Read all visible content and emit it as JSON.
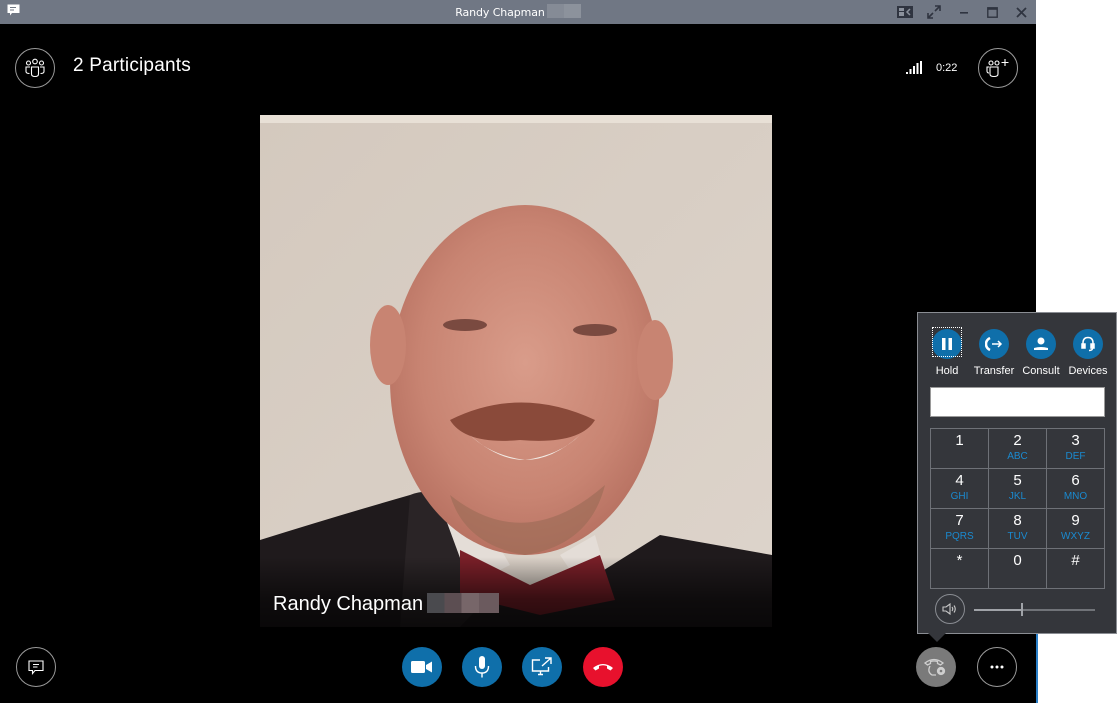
{
  "window": {
    "title": "Randy Chapman",
    "title_redacted": true,
    "controls": [
      "compact-view",
      "full-screen",
      "minimize",
      "maximize",
      "close"
    ]
  },
  "header": {
    "participants_label": "2 Participants",
    "call_duration": "0:22",
    "signal_icon": "signal-strength-icon",
    "add_people_icon": "add-people-icon"
  },
  "video": {
    "participant_name": "Randy Chapman",
    "name_redacted": true
  },
  "toolbar": {
    "im_icon": "chat-icon",
    "video_icon": "video-camera-icon",
    "mic_icon": "microphone-icon",
    "share_icon": "present-screen-icon",
    "hangup_icon": "end-call-icon",
    "call_controls_icon": "call-controls-icon",
    "more_icon": "more-options-icon",
    "colors": {
      "accent": "#0f6faa",
      "hangup": "#e8112d",
      "active_control": "#7a7a7a"
    }
  },
  "dialpad": {
    "actions": [
      {
        "label": "Hold",
        "icon": "pause-icon"
      },
      {
        "label": "Transfer",
        "icon": "transfer-icon"
      },
      {
        "label": "Consult",
        "icon": "person-icon"
      },
      {
        "label": "Devices",
        "icon": "headset-icon"
      }
    ],
    "input_value": "",
    "keys": [
      {
        "digit": "1",
        "letters": ""
      },
      {
        "digit": "2",
        "letters": "ABC"
      },
      {
        "digit": "3",
        "letters": "DEF"
      },
      {
        "digit": "4",
        "letters": "GHI"
      },
      {
        "digit": "5",
        "letters": "JKL"
      },
      {
        "digit": "6",
        "letters": "MNO"
      },
      {
        "digit": "7",
        "letters": "PQRS"
      },
      {
        "digit": "8",
        "letters": "TUV"
      },
      {
        "digit": "9",
        "letters": "WXYZ"
      },
      {
        "digit": "*",
        "letters": ""
      },
      {
        "digit": "0",
        "letters": ""
      },
      {
        "digit": "#",
        "letters": ""
      }
    ],
    "volume_percent": 40,
    "letters_color": "#1a8ad0"
  }
}
